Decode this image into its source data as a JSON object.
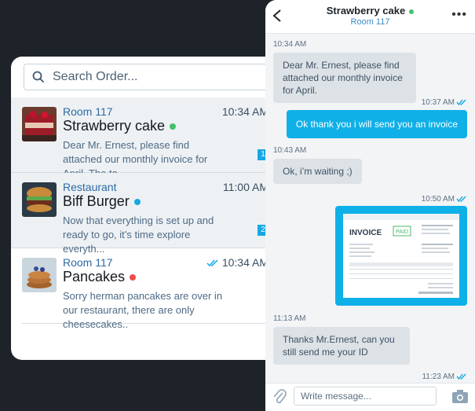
{
  "search": {
    "placeholder": "Search Order..."
  },
  "conversations": [
    {
      "room": "Room 117",
      "title": "Strawberry cake",
      "time": "10:34 AM",
      "preview": "Dear Mr. Ernest, please find attached our monthly invoice for April. The to...",
      "badge": "1",
      "dot_color": "#43c06b"
    },
    {
      "room": "Restaurant",
      "title": "Biff Burger",
      "time": "11:00 AM",
      "preview": "Now that everything is set up and ready to go, it’s time explore everyth...",
      "badge": "2",
      "dot_color": "#16a7e5"
    },
    {
      "room": "Room 117",
      "title": "Pancakes",
      "time": "10:34 AM",
      "preview": "Sorry herman pancakes are over in our restaurant, there are only cheesecakes..",
      "dot_color": "#ee4c4c"
    }
  ],
  "chat": {
    "title": "Strawberry cake",
    "subtitle": "Room 117",
    "status_color": "#43c06b",
    "messages": [
      {
        "time": "10:34 AM",
        "text": "Dear Mr. Ernest, please find attached our monthly invoice for April.",
        "from": "in"
      },
      {
        "time": "10:37 AM",
        "text": "Ok thank you i will send you an invoice",
        "from": "out"
      },
      {
        "time": "10:43 AM",
        "text": "Ok, i’m waiting ;)",
        "from": "in"
      },
      {
        "time": "10:50 AM",
        "image": "invoice",
        "from": "out"
      },
      {
        "time": "11:13 AM",
        "text": "Thanks Mr.Ernest,  can you still send me your ID",
        "from": "in"
      },
      {
        "time": "11:23 AM",
        "from": "out"
      }
    ],
    "invoice": {
      "heading": "INVOICE",
      "stamp": "PAID"
    },
    "composer_placeholder": "Write message..."
  },
  "colors": {
    "accent": "#0fb0e8",
    "background": "#1d2329"
  }
}
